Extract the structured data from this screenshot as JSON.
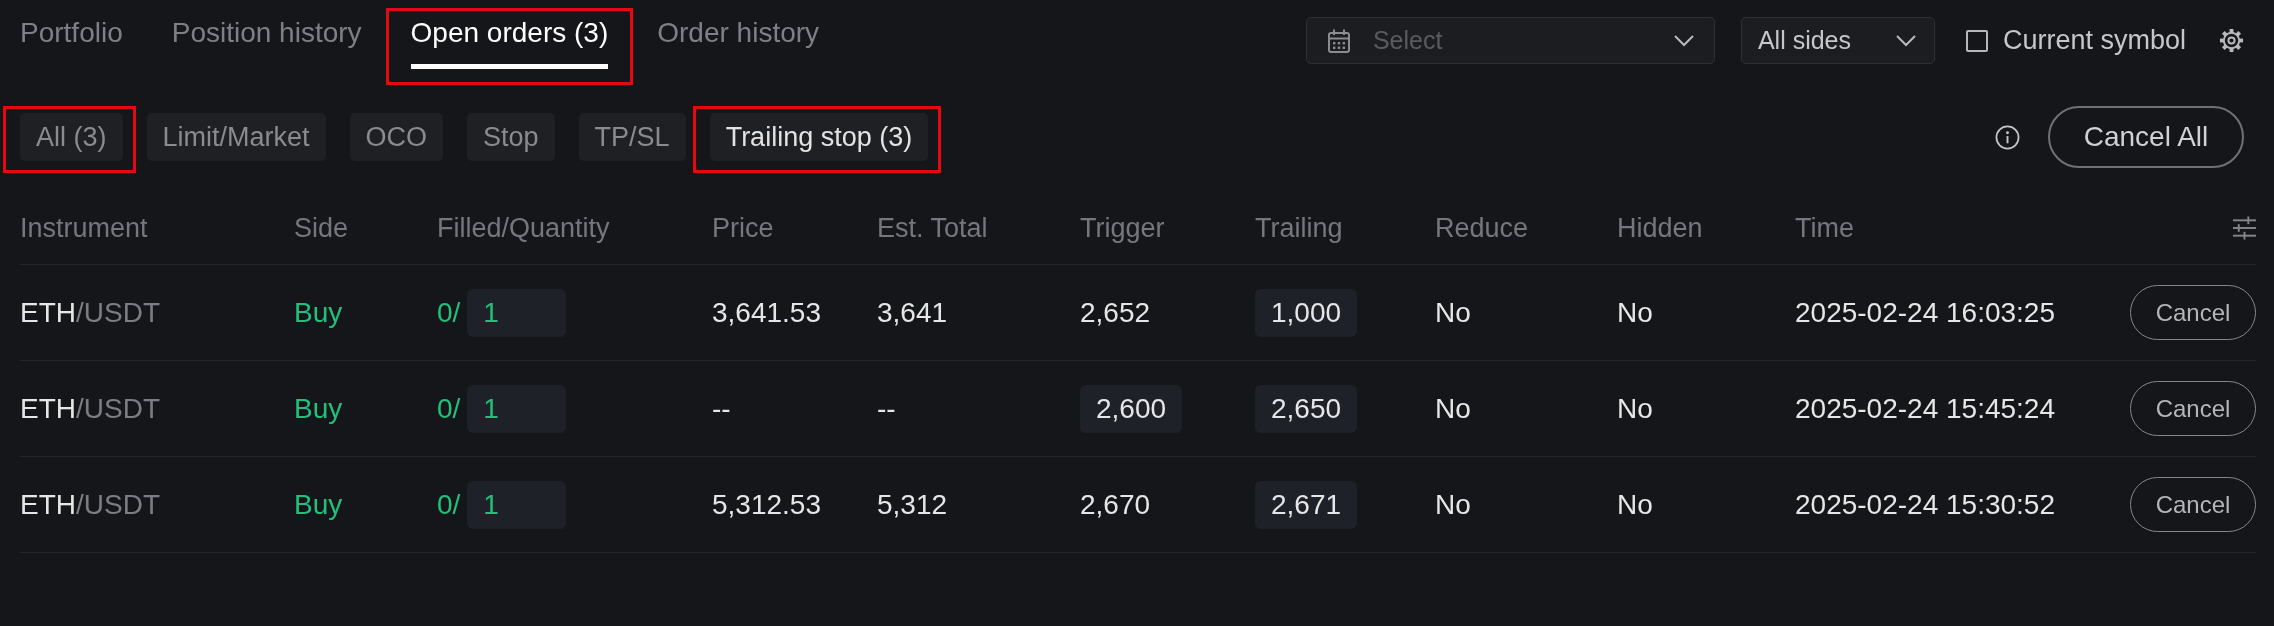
{
  "tabs": [
    {
      "label": "Portfolio",
      "selected": false,
      "highlighted": false
    },
    {
      "label": "Position history",
      "selected": false,
      "highlighted": false
    },
    {
      "label": "Open orders (3)",
      "selected": true,
      "highlighted": true
    },
    {
      "label": "Order history",
      "selected": false,
      "highlighted": false
    }
  ],
  "toolbar": {
    "date_filter": {
      "placeholder": "Select"
    },
    "side_filter": {
      "value": "All sides"
    },
    "current_symbol": {
      "label": "Current symbol",
      "checked": false
    }
  },
  "order_types": [
    {
      "label": "All (3)",
      "selected": false,
      "highlighted": true
    },
    {
      "label": "Limit/Market",
      "selected": false,
      "highlighted": false
    },
    {
      "label": "OCO",
      "selected": false,
      "highlighted": false
    },
    {
      "label": "Stop",
      "selected": false,
      "highlighted": false
    },
    {
      "label": "TP/SL",
      "selected": false,
      "highlighted": false
    },
    {
      "label": "Trailing stop (3)",
      "selected": true,
      "highlighted": true
    }
  ],
  "cancel_all": {
    "label": "Cancel All"
  },
  "table": {
    "columns": [
      "Instrument",
      "Side",
      "Filled/Quantity",
      "Price",
      "Est. Total",
      "Trigger",
      "Trailing",
      "Reduce",
      "Hidden",
      "Time"
    ],
    "rows": [
      {
        "instrument": {
          "base": "ETH",
          "quote": "/USDT"
        },
        "side": {
          "label": "Buy",
          "kind": "buy"
        },
        "filled": "0/",
        "quantity": "1",
        "price": "3,641.53",
        "est_total": "3,641",
        "trigger": {
          "value": "2,652",
          "editable": false
        },
        "trailing": {
          "value": "1,000",
          "editable": true
        },
        "reduce": "No",
        "hidden": "No",
        "time": "2025-02-24 16:03:25",
        "action": "Cancel"
      },
      {
        "instrument": {
          "base": "ETH",
          "quote": "/USDT"
        },
        "side": {
          "label": "Buy",
          "kind": "buy"
        },
        "filled": "0/",
        "quantity": "1",
        "price": "--",
        "est_total": "--",
        "trigger": {
          "value": "2,600",
          "editable": true
        },
        "trailing": {
          "value": "2,650",
          "editable": true
        },
        "reduce": "No",
        "hidden": "No",
        "time": "2025-02-24 15:45:24",
        "action": "Cancel"
      },
      {
        "instrument": {
          "base": "ETH",
          "quote": "/USDT"
        },
        "side": {
          "label": "Buy",
          "kind": "buy"
        },
        "filled": "0/",
        "quantity": "1",
        "price": "5,312.53",
        "est_total": "5,312",
        "trigger": {
          "value": "2,670",
          "editable": false
        },
        "trailing": {
          "value": "2,671",
          "editable": true
        },
        "reduce": "No",
        "hidden": "No",
        "time": "2025-02-24 15:30:52",
        "action": "Cancel"
      }
    ]
  }
}
